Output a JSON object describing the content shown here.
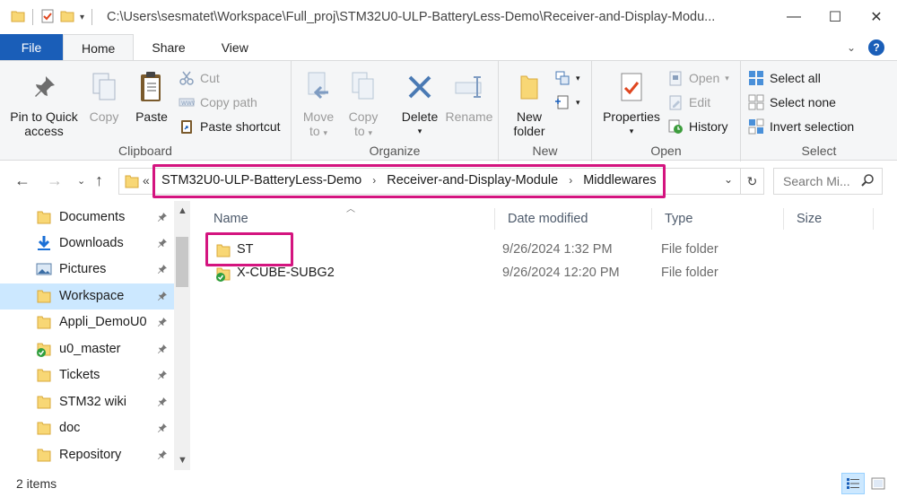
{
  "window": {
    "title": "C:\\Users\\sesmatet\\Workspace\\Full_proj\\STM32U0-ULP-BatteryLess-Demo\\Receiver-and-Display-Modu...",
    "minimize": "—",
    "maximize": "☐",
    "close": "✕"
  },
  "tabs": {
    "file": "File",
    "home": "Home",
    "share": "Share",
    "view": "View"
  },
  "ribbon": {
    "clipboard": {
      "label": "Clipboard",
      "pin_line1": "Pin to Quick",
      "pin_line2": "access",
      "copy": "Copy",
      "paste": "Paste",
      "cut": "Cut",
      "copy_path": "Copy path",
      "paste_shortcut": "Paste shortcut"
    },
    "organize": {
      "label": "Organize",
      "move_line1": "Move",
      "move_line2": "to",
      "copy_line1": "Copy",
      "copy_line2": "to",
      "delete": "Delete",
      "rename": "Rename"
    },
    "new": {
      "label": "New",
      "new_line1": "New",
      "new_line2": "folder"
    },
    "open": {
      "label": "Open",
      "properties": "Properties",
      "open": "Open",
      "edit": "Edit",
      "history": "History"
    },
    "select": {
      "label": "Select",
      "select_all": "Select all",
      "select_none": "Select none",
      "invert": "Invert selection"
    }
  },
  "address": {
    "overflow": "«",
    "crumbs": [
      "STM32U0-ULP-BatteryLess-Demo",
      "Receiver-and-Display-Module",
      "Middlewares"
    ],
    "search_placeholder": "Search Mi..."
  },
  "nav": {
    "items": [
      {
        "label": "Documents",
        "icon": "documents-icon"
      },
      {
        "label": "Downloads",
        "icon": "download-icon"
      },
      {
        "label": "Pictures",
        "icon": "pictures-icon"
      },
      {
        "label": "Workspace",
        "icon": "folder-icon"
      },
      {
        "label": "Appli_DemoU0",
        "icon": "folder-icon"
      },
      {
        "label": "u0_master",
        "icon": "synced-folder-icon"
      },
      {
        "label": "Tickets",
        "icon": "folder-icon"
      },
      {
        "label": "STM32 wiki",
        "icon": "folder-icon"
      },
      {
        "label": "doc",
        "icon": "folder-icon"
      },
      {
        "label": "Repository",
        "icon": "folder-icon"
      }
    ]
  },
  "filelist": {
    "columns": {
      "name": "Name",
      "date": "Date modified",
      "type": "Type",
      "size": "Size"
    },
    "rows": [
      {
        "name": "ST",
        "date": "9/26/2024 1:32 PM",
        "type": "File folder",
        "icon": "folder-icon"
      },
      {
        "name": "X-CUBE-SUBG2",
        "date": "9/26/2024 12:20 PM",
        "type": "File folder",
        "icon": "synced-folder-icon"
      }
    ]
  },
  "status": {
    "count": "2 items"
  },
  "colors": {
    "accent": "#1a5eb8",
    "highlight": "#d4147f",
    "folder": "#f8d775",
    "selection": "#cce8ff"
  }
}
